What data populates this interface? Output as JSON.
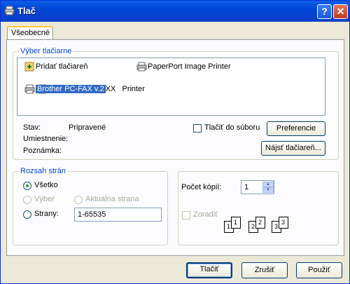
{
  "window": {
    "title": "Tlač",
    "help_label": "?",
    "close_label": "✕"
  },
  "tabs": [
    {
      "label": "Všeobecné"
    }
  ],
  "printer_selection": {
    "legend": "Výber tlačiarne",
    "printers": [
      {
        "label": "Pridať tlačiareň",
        "icon": "add-printer-icon"
      },
      {
        "label": "PaperPort Image Printer",
        "icon": "printer-icon"
      },
      {
        "label": "Brother MFC-XXXX   Printer",
        "icon": "printer-icon"
      },
      {
        "label": "Brother PC-FAX v.2",
        "icon": "printer-icon",
        "selected": true
      }
    ],
    "status_label": "Stav:",
    "status_value": "Pripravené",
    "location_label": "Umiestnenie:",
    "comment_label": "Poznámka:",
    "print_to_file_label": "Tlačiť do súboru",
    "preferences_label": "Preferencie",
    "find_printer_label": "Nájsť tlačiareň..."
  },
  "page_range": {
    "legend": "Rozsah strán",
    "all_label": "Všetko",
    "selection_label": "Výber",
    "current_page_label": "Aktuálna strana",
    "pages_label": "Strany:",
    "pages_value": "1-65535"
  },
  "copies": {
    "count_label": "Počet kópií:",
    "count_value": "1",
    "collate_label": "Zoradiť",
    "collate_pages": [
      "1",
      "1",
      "2",
      "2",
      "3",
      "3"
    ]
  },
  "footer": {
    "print_label": "Tlačiť",
    "cancel_label": "Zrušiť",
    "apply_label": "Použiť"
  }
}
